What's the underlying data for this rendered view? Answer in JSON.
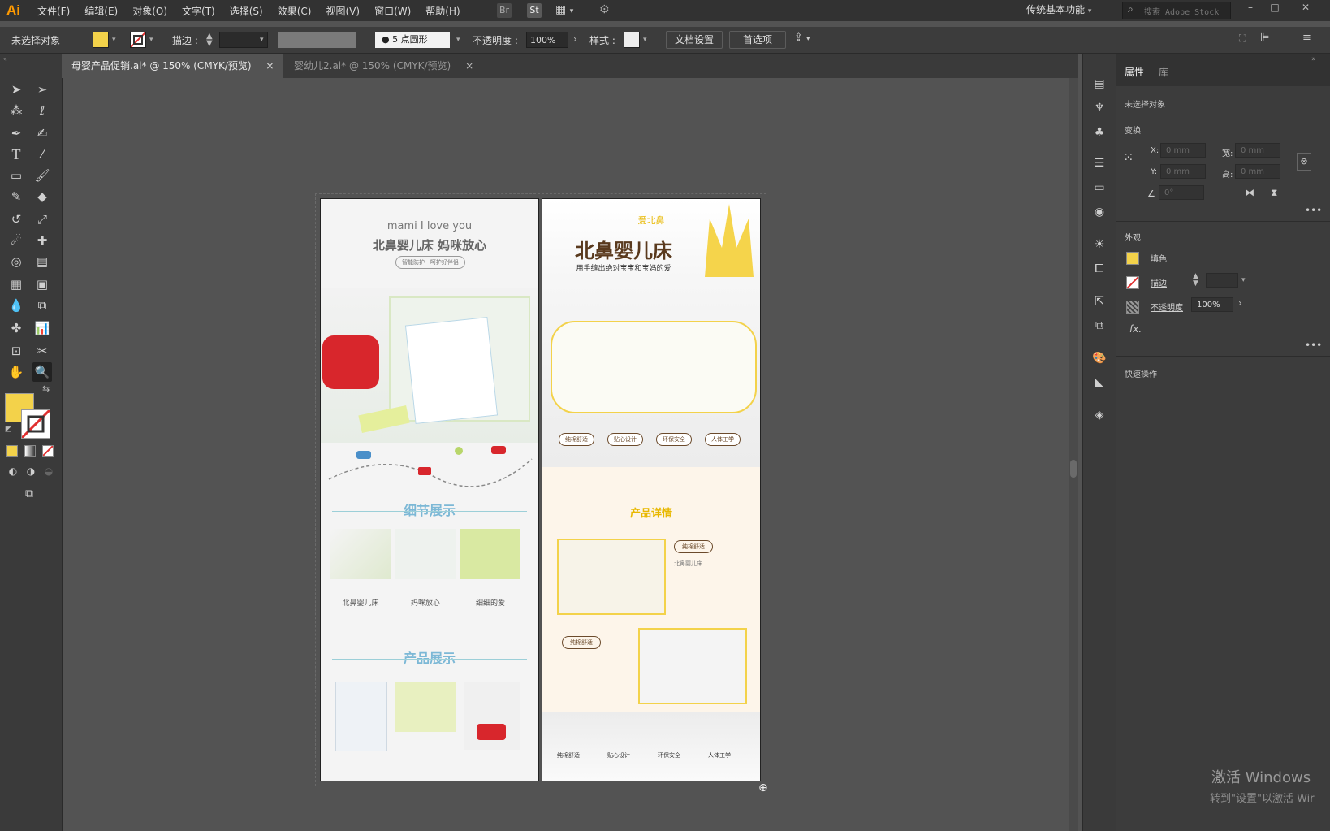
{
  "app": {
    "logo": "Ai",
    "colors": {
      "accent": "#ff9a00",
      "fill": "#f3d24a",
      "stroke_none": "#e03030"
    }
  },
  "menu": [
    "文件(F)",
    "编辑(E)",
    "对象(O)",
    "文字(T)",
    "选择(S)",
    "效果(C)",
    "视图(V)",
    "窗口(W)",
    "帮助(H)"
  ],
  "menubar_icons": {
    "br": "Br",
    "st": "St"
  },
  "workspace": "传统基本功能",
  "stock_search": {
    "placeholder": "搜索 Adobe Stock"
  },
  "window_controls": {
    "minimize": "–",
    "maximize": "□",
    "close": "✕"
  },
  "control": {
    "selection": "未选择对象",
    "stroke_label": "描边 :",
    "brush": "5 点圆形",
    "opacity_label": "不透明度 :",
    "opacity_value": "100%",
    "style_label": "样式 :",
    "doc_setup": "文档设置",
    "preferences": "首选项"
  },
  "tabs": [
    {
      "label": "母婴产品促销.ai* @ 150% (CMYK/预览)",
      "close": "×"
    },
    {
      "label": "婴幼儿2.ai* @ 150% (CMYK/预览)",
      "close": "×"
    }
  ],
  "artboard1": {
    "heading_en": "mami I love you",
    "heading_cn": "北鼻婴儿床 妈咪放心",
    "pill": "智能防护 · 呵护好伴侣",
    "section1": "细节展示",
    "captions": [
      "北鼻婴儿床",
      "妈咪放心",
      "细细的爱"
    ],
    "section2": "产品展示"
  },
  "artboard2": {
    "tag": "爱北鼻",
    "title": "北鼻婴儿床",
    "subtitle": "用手缝出绝对宝宝和宝妈的爱",
    "badges": [
      "纯棉舒适",
      "贴心设计",
      "环保安全",
      "人体工学"
    ],
    "section": "产品详情",
    "detail_label1": "纯棉舒适",
    "detail_label2": "纯棉舒适",
    "detail_title": "北鼻婴儿床",
    "bottom_items": [
      "纯棉舒适",
      "贴心设计",
      "环保安全",
      "人体工学"
    ]
  },
  "properties": {
    "tabs": [
      "属性",
      "库"
    ],
    "selection": "未选择对象",
    "transform": "变换",
    "x_label": "X:",
    "y_label": "Y:",
    "w_label": "宽:",
    "h_label": "高:",
    "zero": "0 mm",
    "angle": "0°",
    "appearance": "外观",
    "fill": "填色",
    "stroke": "描边",
    "opacity": "不透明度",
    "opacity_value": "100%",
    "fx": "fx.",
    "quick_actions": "快速操作"
  },
  "watermark": {
    "line1": "激活 Windows",
    "line2": "转到\"设置\"以激活 Wir"
  }
}
